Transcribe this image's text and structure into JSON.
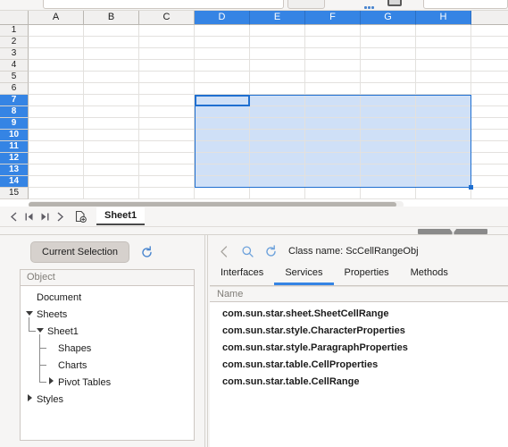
{
  "toolbar": {
    "icons": [
      "color-dots-icon",
      "camera-icon"
    ]
  },
  "spreadsheet": {
    "columns": [
      "A",
      "B",
      "C",
      "D",
      "E",
      "F",
      "G",
      "H"
    ],
    "selected_columns": [
      "D",
      "E",
      "F",
      "G",
      "H"
    ],
    "rows": [
      1,
      2,
      3,
      4,
      5,
      6,
      7,
      8,
      9,
      10,
      11,
      12,
      13,
      14,
      15
    ],
    "selected_rows": [
      7,
      8,
      9,
      10,
      11,
      12,
      13,
      14
    ],
    "active_cell": "D7",
    "selected_range": "D7:H14",
    "header_selected_color": "#3584e4",
    "selection_fill_color": "#cfe0f7",
    "selection_border_color": "#1f6fd0"
  },
  "sheet_bar": {
    "nav": [
      {
        "name": "first-sheet-button",
        "glyph": "first"
      },
      {
        "name": "previous-sheet-button",
        "glyph": "prev"
      },
      {
        "name": "next-sheet-button",
        "glyph": "next"
      },
      {
        "name": "last-sheet-button",
        "glyph": "last"
      },
      {
        "name": "add-sheet-button",
        "glyph": "add"
      }
    ],
    "tabs": [
      {
        "label": "Sheet1",
        "active": true
      }
    ]
  },
  "devtools": {
    "left": {
      "current_selection_label": "Current Selection",
      "refresh_icon": "refresh-icon",
      "tree_header": "Object",
      "tree": [
        {
          "label": "Document",
          "depth": 0,
          "marker": "none"
        },
        {
          "label": "Sheets",
          "depth": 0,
          "marker": "expanded"
        },
        {
          "label": "Sheet1",
          "depth": 1,
          "marker": "expanded"
        },
        {
          "label": "Shapes",
          "depth": 2,
          "marker": "leaf"
        },
        {
          "label": "Charts",
          "depth": 2,
          "marker": "leaf"
        },
        {
          "label": "Pivot Tables",
          "depth": 2,
          "marker": "collapsed"
        },
        {
          "label": "Styles",
          "depth": 0,
          "marker": "collapsed"
        }
      ]
    },
    "right": {
      "back_icon": "back-arrow-icon",
      "search_icon": "search-icon",
      "refresh_icon": "refresh-icon",
      "class_name_label": "Class name:",
      "class_name_value": "ScCellRangeObj",
      "tabs": [
        {
          "label": "Interfaces",
          "active": false
        },
        {
          "label": "Services",
          "active": true
        },
        {
          "label": "Properties",
          "active": false
        },
        {
          "label": "Methods",
          "active": false
        }
      ],
      "list_header": "Name",
      "list_items": [
        "com.sun.star.sheet.SheetCellRange",
        "com.sun.star.style.CharacterProperties",
        "com.sun.star.style.ParagraphProperties",
        "com.sun.star.table.CellProperties",
        "com.sun.star.table.CellRange"
      ]
    }
  }
}
